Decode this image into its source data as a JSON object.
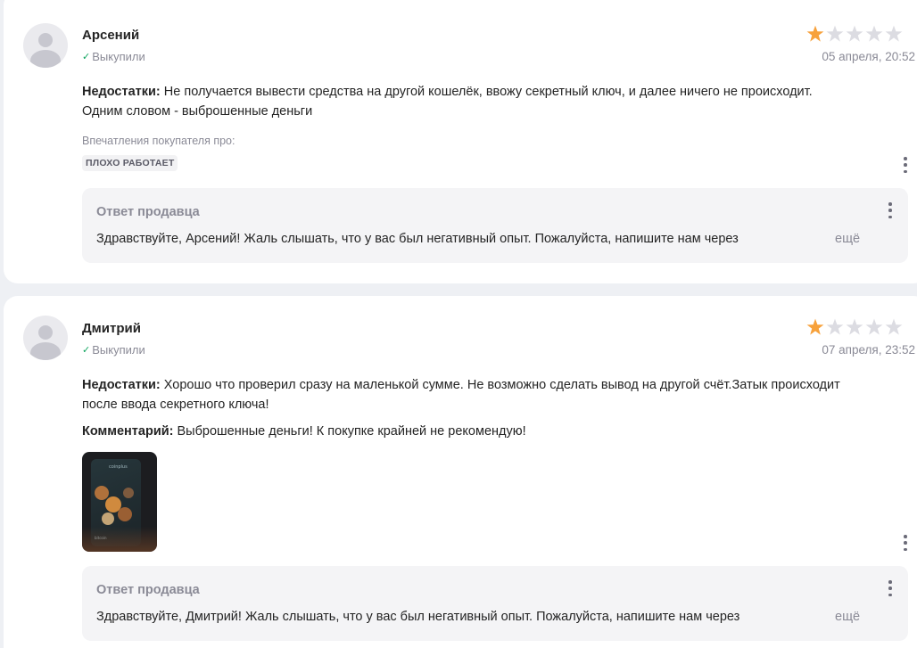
{
  "reviews": [
    {
      "author": "Арсений",
      "bought_label": "Выкупили",
      "rating": 1,
      "max_rating": 5,
      "date": "05 апреля, 20:52",
      "cons_label": "Недостатки:",
      "cons_text": "Не получается вывести средства на другой кошелёк, ввожу секретный ключ, и далее ничего не происходит. Одним словом - выброшенные деньги",
      "impressions_label": "Впечатления покупателя про:",
      "impression_tag": "ПЛОХО РАБОТАЕТ",
      "reply": {
        "title": "Ответ продавца",
        "text": "Здравствуйте, Арсений! Жаль слышать, что у вас был негативный опыт. Пожалуйста, напишите нам через",
        "more": "ещё"
      }
    },
    {
      "author": "Дмитрий",
      "bought_label": "Выкупили",
      "rating": 1,
      "max_rating": 5,
      "date": "07 апреля, 23:52",
      "cons_label": "Недостатки:",
      "cons_text": "Хорошо что проверил сразу на маленькой сумме. Не возможно сделать вывод на другой счёт.Затык происходит после ввода секретного ключа!",
      "comment_label": "Комментарий:",
      "comment_text": "Выброшенные деньги! К покупке крайней не рекомендую!",
      "photo": {
        "caption_top": "coinplus",
        "caption_bottom": "bitcoin"
      },
      "reply": {
        "title": "Ответ продавца",
        "text": "Здравствуйте, Дмитрий! Жаль слышать, что у вас был негативный опыт. Пожалуйста, напишите нам через",
        "more": "ещё"
      }
    }
  ],
  "icons": {
    "check": "check-icon",
    "star": "star-icon",
    "more": "kebab-menu-icon",
    "avatar": "user-avatar-icon"
  },
  "colors": {
    "star_filled": "#f7a13b",
    "star_empty": "#dcdce2",
    "bought_check": "#11a55f",
    "muted_text": "#8a8a96",
    "card_bg": "#ffffff",
    "reply_bg": "#f4f4f6",
    "page_bg": "#eef0f4"
  }
}
